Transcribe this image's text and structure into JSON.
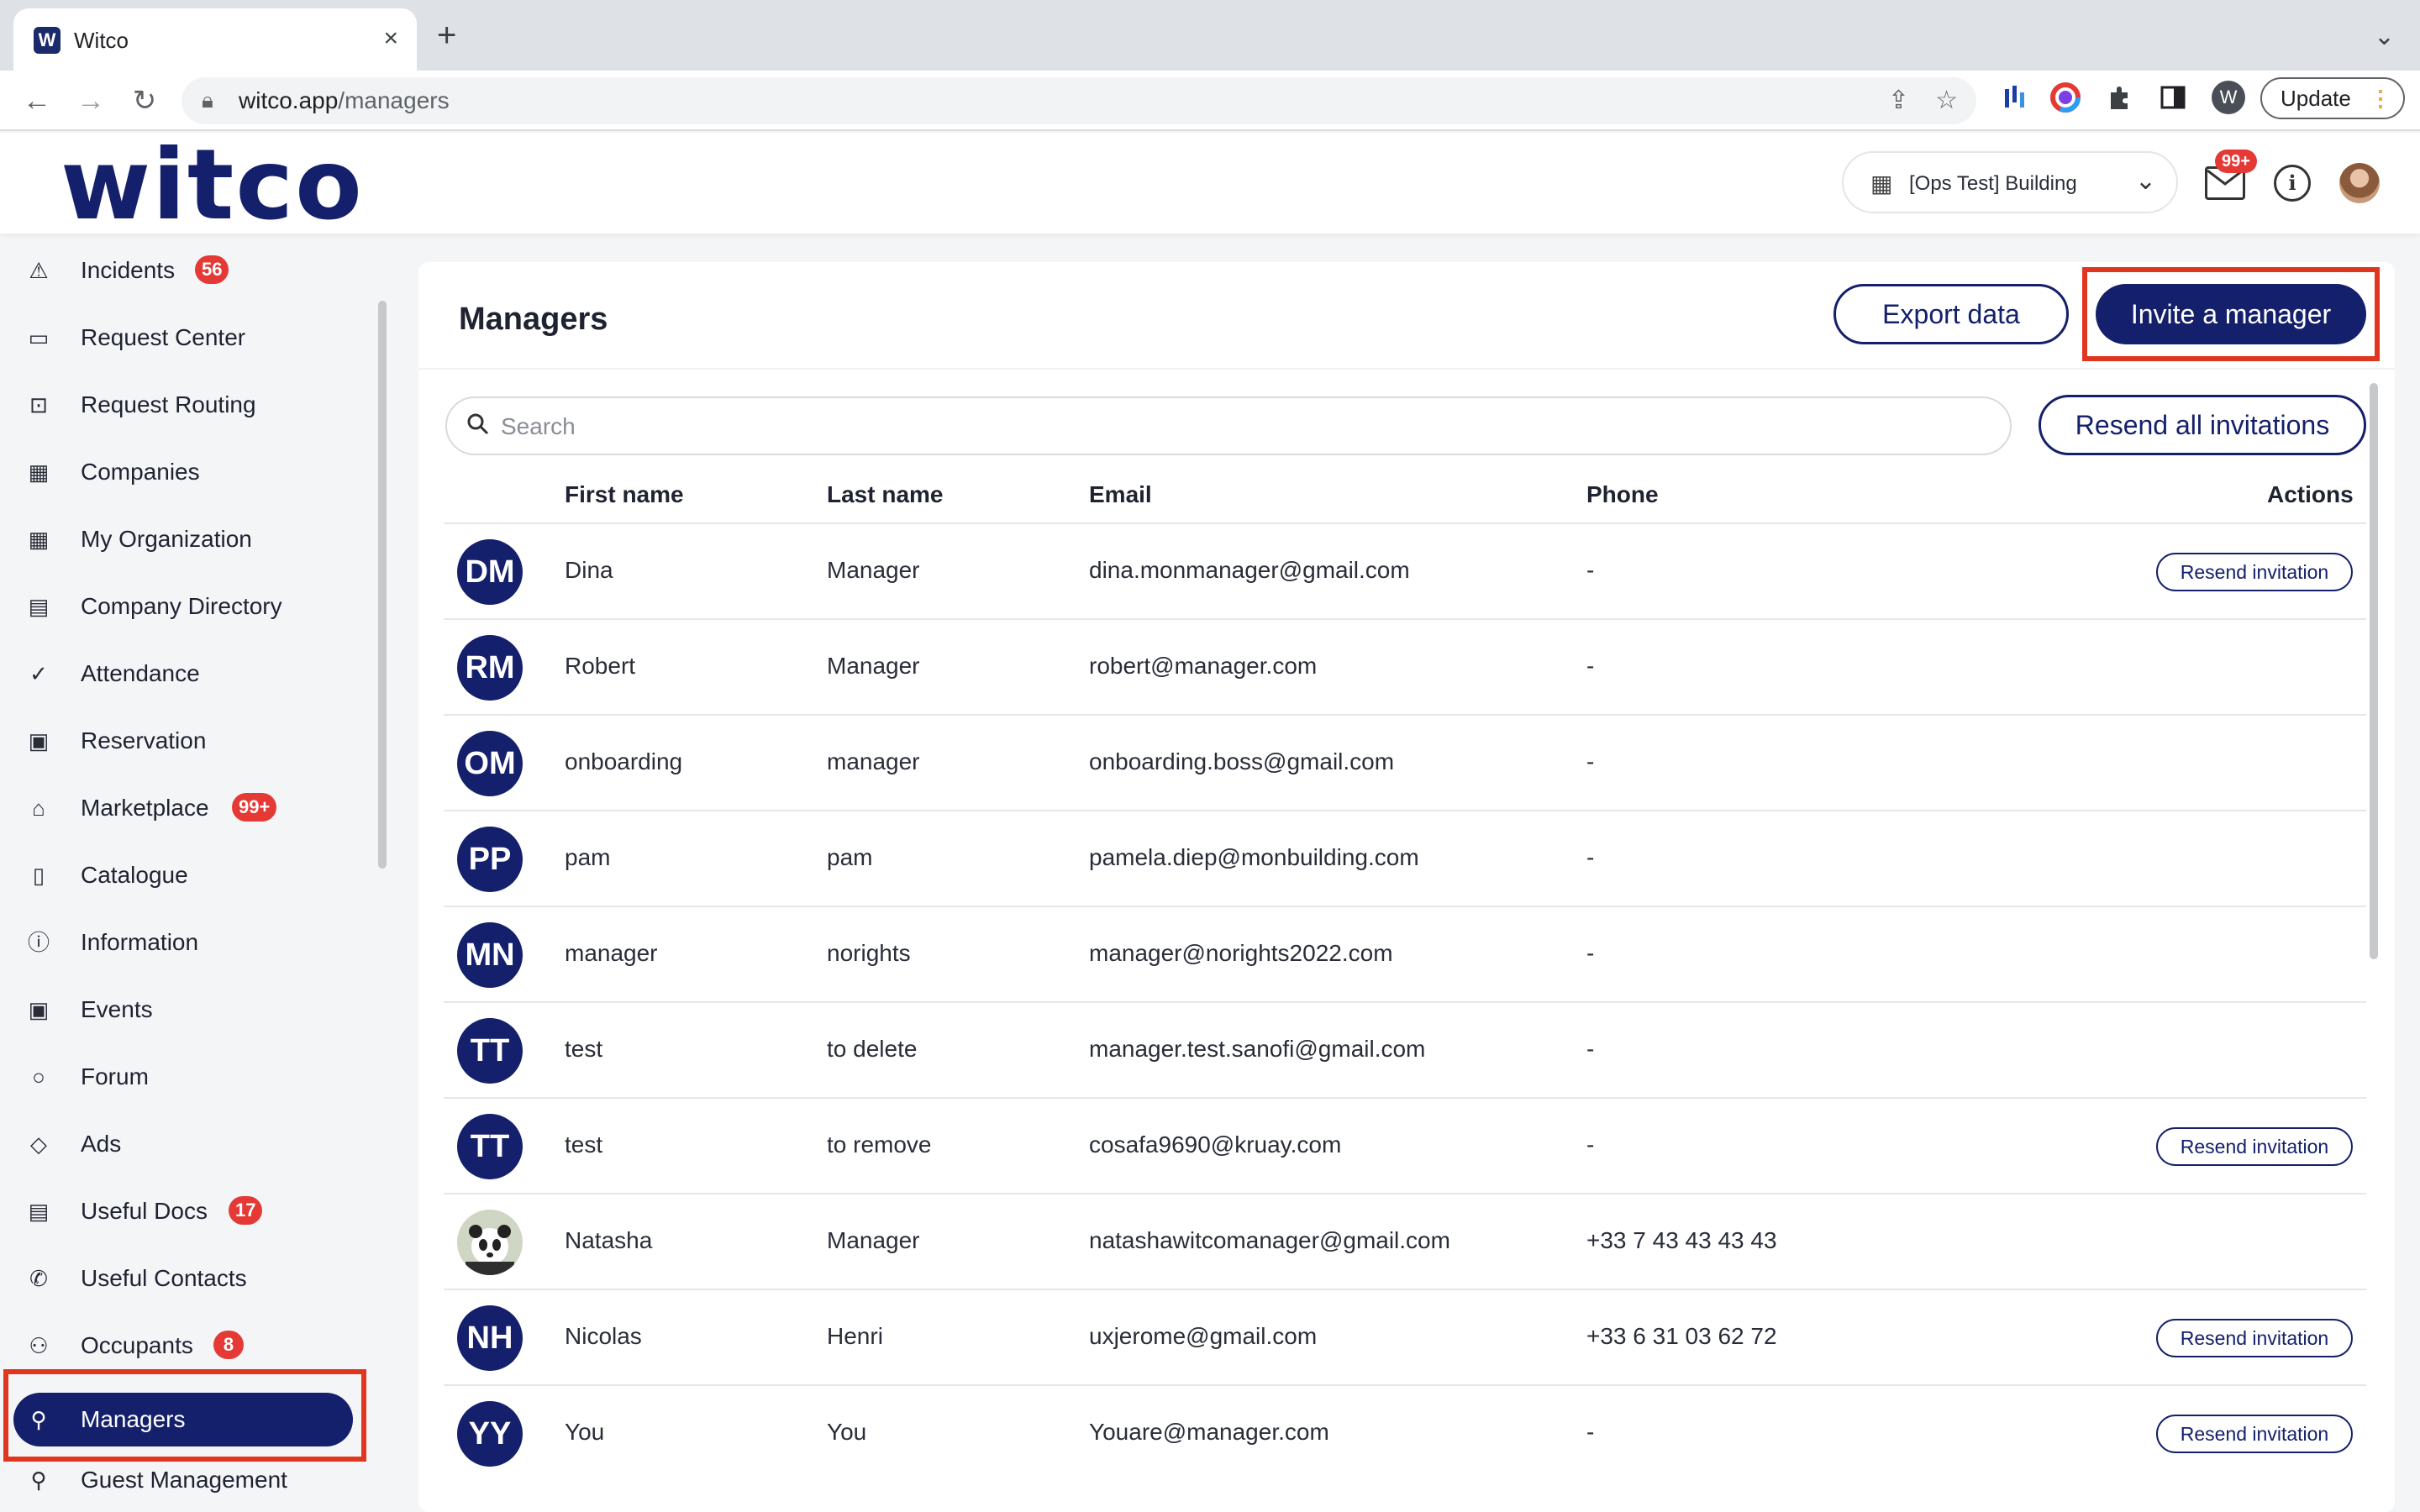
{
  "browser": {
    "tab_title": "Witco",
    "tab_favicon": "W",
    "tab_close": "×",
    "new_tab": "+",
    "url_host": "witco.app",
    "url_path": "/managers",
    "profile_initial": "W",
    "update_label": "Update"
  },
  "header": {
    "logo": "witco",
    "building": "[Ops Test] Building",
    "mail_badge": "99+"
  },
  "sidebar": {
    "items": [
      {
        "label": "Incidents",
        "icon": "warning-icon",
        "badge": "56"
      },
      {
        "label": "Request Center",
        "icon": "chat-icon",
        "badge": ""
      },
      {
        "label": "Request Routing",
        "icon": "routing-icon",
        "badge": ""
      },
      {
        "label": "Companies",
        "icon": "building-icon",
        "badge": ""
      },
      {
        "label": "My Organization",
        "icon": "building-icon",
        "badge": ""
      },
      {
        "label": "Company Directory",
        "icon": "directory-icon",
        "badge": ""
      },
      {
        "label": "Attendance",
        "icon": "check-circle-icon",
        "badge": ""
      },
      {
        "label": "Reservation",
        "icon": "calendar-icon",
        "badge": ""
      },
      {
        "label": "Marketplace",
        "icon": "store-icon",
        "badge": "99+"
      },
      {
        "label": "Catalogue",
        "icon": "book-icon",
        "badge": ""
      },
      {
        "label": "Information",
        "icon": "info-icon",
        "badge": ""
      },
      {
        "label": "Events",
        "icon": "calendar-event-icon",
        "badge": ""
      },
      {
        "label": "Forum",
        "icon": "speech-bubble-icon",
        "badge": ""
      },
      {
        "label": "Ads",
        "icon": "tag-icon",
        "badge": ""
      },
      {
        "label": "Useful Docs",
        "icon": "document-icon",
        "badge": "17"
      },
      {
        "label": "Useful Contacts",
        "icon": "phone-icon",
        "badge": ""
      },
      {
        "label": "Occupants",
        "icon": "users-icon",
        "badge": "8"
      },
      {
        "label": "Managers",
        "icon": "user-icon",
        "badge": ""
      },
      {
        "label": "Guest Management",
        "icon": "guest-icon",
        "badge": ""
      }
    ]
  },
  "main": {
    "title": "Managers",
    "export_label": "Export data",
    "invite_label": "Invite a manager",
    "search_placeholder": "Search",
    "resend_all_label": "Resend all invitations",
    "columns": [
      "First name",
      "Last name",
      "Email",
      "Phone",
      "Actions"
    ],
    "resend_label": "Resend invitation",
    "rows": [
      {
        "initials": "DM",
        "first": "Dina",
        "last": "Manager",
        "email": "dina.monmanager@gmail.com",
        "phone": "-",
        "resend": true
      },
      {
        "initials": "RM",
        "first": "Robert",
        "last": "Manager",
        "email": "robert@manager.com",
        "phone": "-",
        "resend": false
      },
      {
        "initials": "OM",
        "first": "onboarding",
        "last": "manager",
        "email": "onboarding.boss@gmail.com",
        "phone": "-",
        "resend": false
      },
      {
        "initials": "PP",
        "first": "pam",
        "last": "pam",
        "email": "pamela.diep@monbuilding.com",
        "phone": "-",
        "resend": false
      },
      {
        "initials": "MN",
        "first": "manager",
        "last": "norights",
        "email": "manager@norights2022.com",
        "phone": "-",
        "resend": false
      },
      {
        "initials": "TT",
        "first": "test",
        "last": "to delete",
        "email": "manager.test.sanofi@gmail.com",
        "phone": "-",
        "resend": false
      },
      {
        "initials": "TT",
        "first": "test",
        "last": "to remove",
        "email": "cosafa9690@kruay.com",
        "phone": "-",
        "resend": true
      },
      {
        "initials": "",
        "first": "Natasha",
        "last": "Manager",
        "email": "natashawitcomanager@gmail.com",
        "phone": "+33 7 43 43 43 43",
        "resend": false,
        "photo": true
      },
      {
        "initials": "NH",
        "first": "Nicolas",
        "last": "Henri",
        "email": "uxjerome@gmail.com",
        "phone": "+33 6 31 03 62 72",
        "resend": true
      },
      {
        "initials": "YY",
        "first": "You",
        "last": "You",
        "email": "Youare@manager.com",
        "phone": "-",
        "resend": true
      }
    ]
  },
  "colors": {
    "brand": "#14206b",
    "badge": "#e53935",
    "highlight": "#e0361f"
  }
}
